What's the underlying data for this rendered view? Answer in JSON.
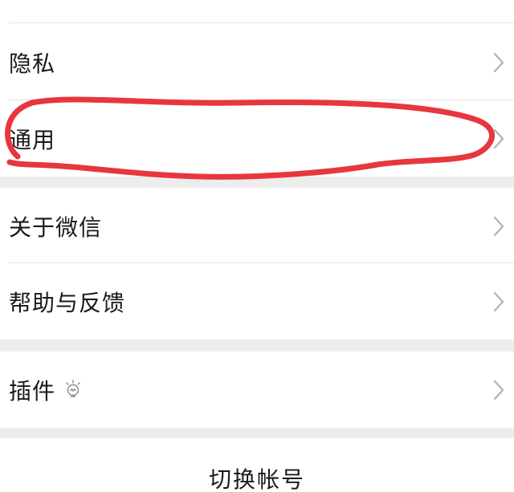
{
  "settings": {
    "items": [
      {
        "label": "隐私"
      },
      {
        "label": "通用"
      },
      {
        "label": "关于微信"
      },
      {
        "label": "帮助与反馈"
      },
      {
        "label": "插件"
      }
    ],
    "switch_account_label": "切换帐号"
  },
  "colors": {
    "background": "#ededed",
    "row": "#ffffff",
    "chevron": "#b2b2b2",
    "highlight_marker": "#e8363f"
  },
  "icons": {
    "chevron": "chevron-right-icon",
    "plugin_badge": "lightbulb-icon"
  }
}
